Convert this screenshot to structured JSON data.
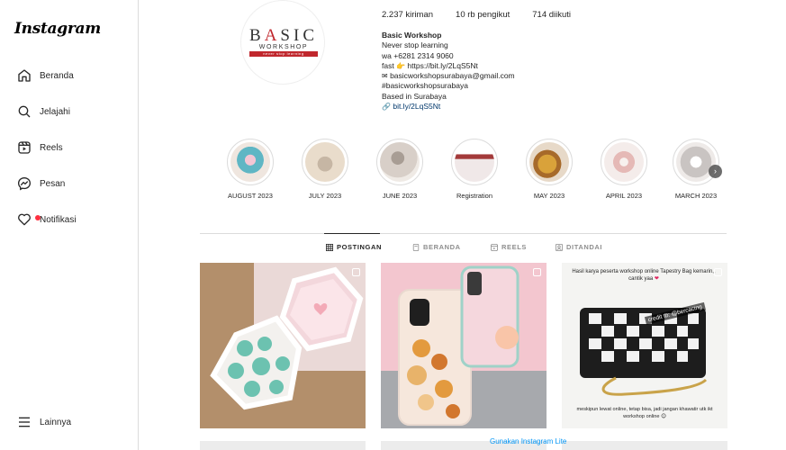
{
  "sidebar": {
    "logo": "Instagram",
    "items": [
      {
        "label": "Beranda",
        "icon": "home-icon"
      },
      {
        "label": "Jelajahi",
        "icon": "search-icon"
      },
      {
        "label": "Reels",
        "icon": "reels-icon"
      },
      {
        "label": "Pesan",
        "icon": "messenger-icon"
      },
      {
        "label": "Notifikasi",
        "icon": "heart-icon"
      }
    ],
    "more": {
      "label": "Lainnya",
      "icon": "menu-icon"
    }
  },
  "profile": {
    "avatar_text": {
      "line1_pre": "B",
      "line1_accent": "A",
      "line1_post": "SIC",
      "line2": "WORKSHOP",
      "line3": "never stop learning"
    },
    "stats": {
      "posts": "2.237 kiriman",
      "followers": "10 rb pengikut",
      "following": "714 diikuti"
    },
    "bio": {
      "name": "Basic Workshop",
      "lines": [
        "Never stop learning",
        "wa +6281 2314 9060"
      ],
      "fast_prefix": "fast",
      "fast_link": "https://bit.ly/2LqS5Nt",
      "email": "basicworkshopsurabaya@gmail.com",
      "hashtag": "#basicworkshopsurabaya",
      "location": "Based in Surabaya",
      "link": "bit.ly/2LqS5Nt"
    }
  },
  "highlights": [
    {
      "label": "AUGUST 2023",
      "color": "#5fb6c4"
    },
    {
      "label": "JULY 2023",
      "color": "#e9dccb"
    },
    {
      "label": "JUNE 2023",
      "color": "#d8cfc8"
    },
    {
      "label": "Registration",
      "color": "#a33a3a"
    },
    {
      "label": "MAY 2023",
      "color": "#d9a23a"
    },
    {
      "label": "APRIL 2023",
      "color": "#e5b9b6"
    },
    {
      "label": "MARCH 2023",
      "color": "#c9c4c2"
    }
  ],
  "tabs": [
    {
      "label": "POSTINGAN",
      "icon": "grid-icon",
      "active": true
    },
    {
      "label": "BERANDA",
      "icon": "feed-icon",
      "active": false
    },
    {
      "label": "REELS",
      "icon": "reels-tab-icon",
      "active": false
    },
    {
      "label": "DITANDAI",
      "icon": "tagged-icon",
      "active": false
    }
  ],
  "posts": [
    {
      "alt": "hexagon resin trays",
      "bg": "#ead9d7"
    },
    {
      "alt": "decorated phone cases",
      "bg": "#e8dcd4"
    },
    {
      "caption": "Hasil karya peserta workshop online Tapestry Bag kemarin,, cantik yaa",
      "overlay": "credit to: @bercacing",
      "footer": "meskipun lewat online, tetap bisa, jadi jangan khawatir utk ikt workshop online",
      "bg": "#f4f4f2"
    }
  ],
  "footer": {
    "lite": "Gunakan Instagram Lite"
  },
  "colors": {
    "accent": "#0095f6",
    "brand_red": "#c0272d",
    "notif": "#ff3040"
  }
}
